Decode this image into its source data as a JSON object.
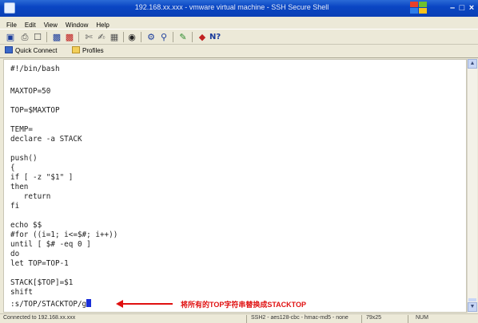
{
  "window": {
    "title": "192.168.xx.xxx - vmware virtual machine - SSH Secure Shell"
  },
  "menu": [
    "File",
    "Edit",
    "View",
    "Window",
    "Help"
  ],
  "toolbar_icons": [
    "save-icon",
    "print-icon",
    "print-preview-icon",
    "cut-icon",
    "copy-icon",
    "paste-icon",
    "find-icon",
    "settings-icon",
    "binoculars-icon",
    "new-connection-icon",
    "disconnect-icon",
    "keyboard-icon",
    "help-icon"
  ],
  "quickbar": {
    "quick_connect": "Quick Connect",
    "profiles": "Profiles"
  },
  "terminal": {
    "lines": [
      "#!/bin/bash",
      "",
      "MAXTOP=50",
      "",
      "TOP=$MAXTOP",
      "",
      "TEMP=",
      "declare -a STACK",
      "",
      "push()",
      "{",
      "if [ -z \"$1\" ]",
      "then",
      "   return",
      "fi",
      "",
      "echo $$",
      "#for ((i=1; i<=$#; i++))",
      "until [ $# -eq 0 ]",
      "do",
      "let TOP=TOP-1",
      "",
      "STACK[$TOP]=$1",
      "shift",
      ":s/TOP/STACKTOP/g"
    ],
    "annotation": "将所有的TOP字符串替换成STACKTOP"
  },
  "statusbar": {
    "connection": "Connected to 192.168.xx.xxx",
    "encryption": "SSH2 - aes128-cbc - hmac-md5 - none",
    "size": "79x25",
    "extra": "NUM"
  },
  "colors": {
    "titlebar": "#0a46c3",
    "annotation": "#e01010",
    "cursor": "#1a2fd8"
  }
}
